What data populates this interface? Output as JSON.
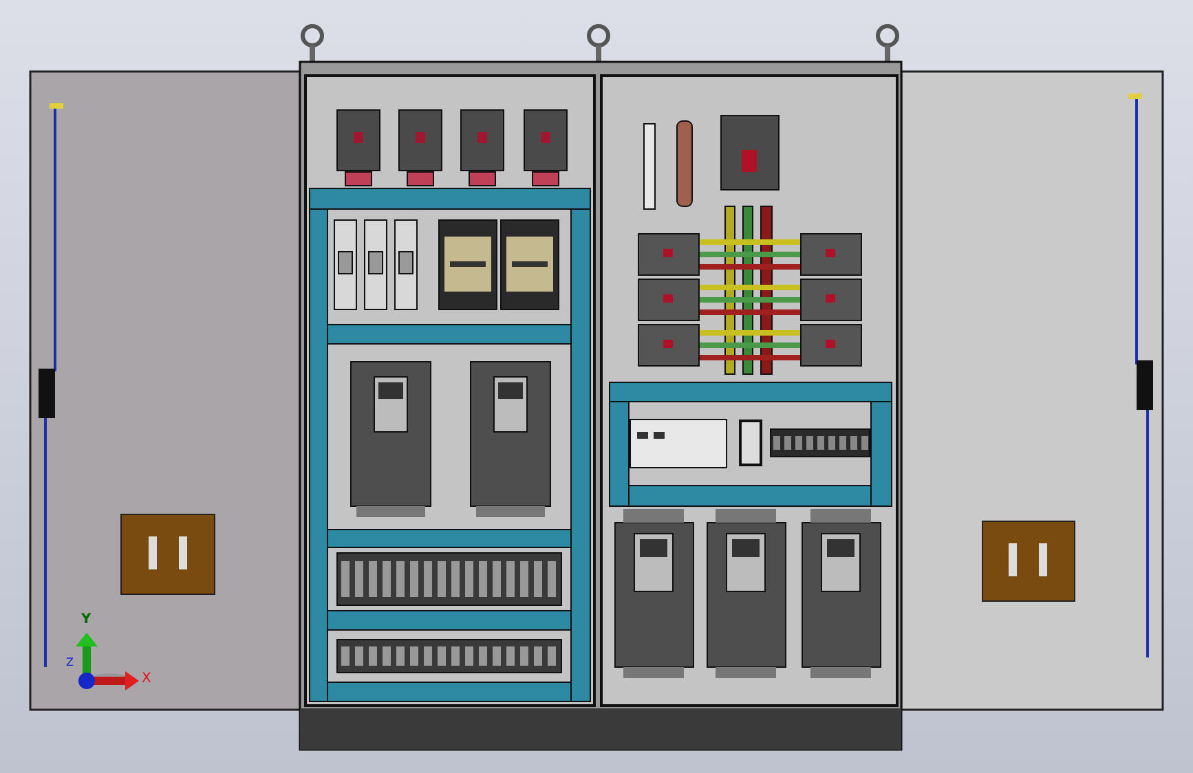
{
  "viewport": {
    "triad": {
      "x_label": "X",
      "y_label": "Y",
      "z_label": "Z"
    }
  }
}
